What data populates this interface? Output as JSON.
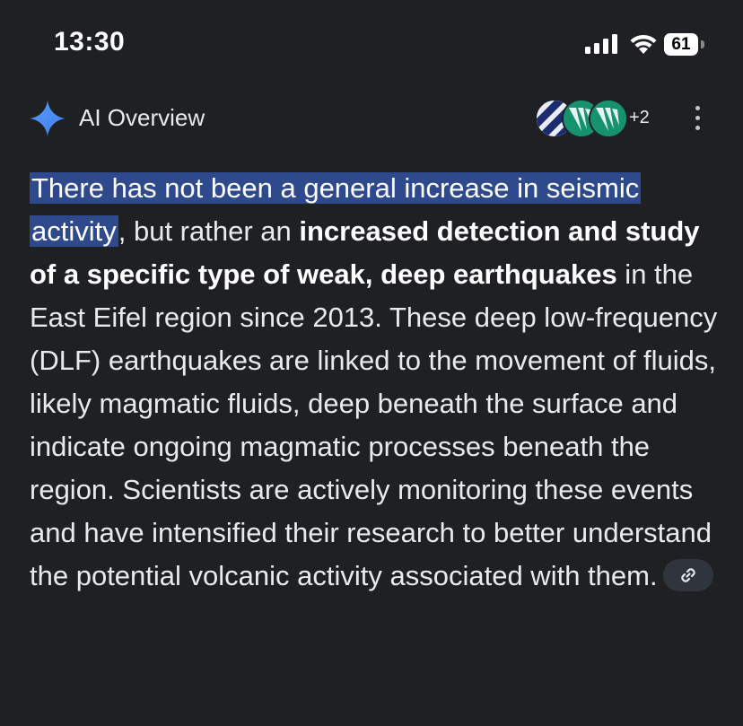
{
  "status_bar": {
    "time": "13:30",
    "battery": "61",
    "icons": [
      "signal-icon",
      "wifi-icon",
      "battery-icon"
    ]
  },
  "overview": {
    "title": "AI Overview",
    "icon": "sparkle-icon",
    "sources_more": "+2",
    "menu_icon": "more-vert-icon"
  },
  "answer": {
    "highlight": "There has not been a general increase in seismic activity",
    "part2": ", but rather an ",
    "bold1": "increased detection and study of a specific type of weak, deep earthquakes",
    "part3": " in the East Eifel region since 2013. These deep low-frequency (DLF) earthquakes are linked to the movement of fluids, likely magmatic fluids, deep beneath the surface and indicate ongoing magmatic processes beneath the region. Scientists are actively monitoring these events and have intensified their research to better understand the potential volcanic activity associated with them.",
    "link_icon": "link-icon"
  },
  "colors": {
    "background": "#1f2024",
    "highlight": "#2f4a8c",
    "sparkle": "#4f8df5",
    "chip": "#30343c"
  }
}
